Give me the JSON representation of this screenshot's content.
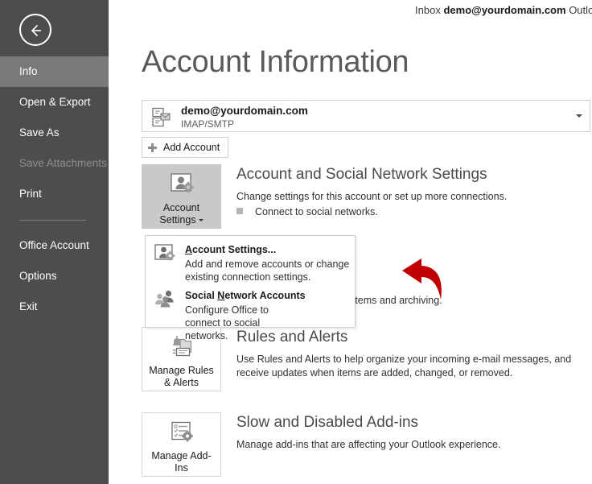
{
  "window": {
    "topbar": {
      "prefix": "Inbox",
      "account": "demo@yourdomain.com",
      "suffix": "Outlook"
    }
  },
  "sidebar": {
    "back_button": "back-arrow-icon",
    "items": [
      {
        "label": "Info",
        "state": "selected"
      },
      {
        "label": "Open & Export",
        "state": "normal"
      },
      {
        "label": "Save As",
        "state": "normal"
      },
      {
        "label": "Save Attachments",
        "state": "disabled"
      },
      {
        "label": "Print",
        "state": "normal"
      },
      {
        "label": "Office Account",
        "state": "normal"
      },
      {
        "label": "Options",
        "state": "normal"
      },
      {
        "label": "Exit",
        "state": "normal"
      }
    ]
  },
  "main": {
    "page_title": "Account Information",
    "account_selector": {
      "email": "demo@yourdomain.com",
      "type": "IMAP/SMTP",
      "icon": "mail-account-icon",
      "chevron": "chevron-down-icon"
    },
    "add_account_button": "Add Account",
    "sections": [
      {
        "button_label_line1": "Account",
        "button_label_line2": "Settings",
        "title": "Account and Social Network Settings",
        "desc": "Change settings for this account or set up more connections.",
        "bullet": "Connect to social networks."
      },
      {
        "button_label_line1": "Manage Rules",
        "button_label_line2": "& Alerts",
        "title": "Rules and Alerts",
        "desc": "Use Rules and Alerts to help organize your incoming e-mail messages, and receive updates when items are added, changed, or removed."
      },
      {
        "button_label_line1": "Manage Add-",
        "button_label_line2": "Ins",
        "title": "Slow and Disabled Add-ins",
        "desc": "Manage add-ins that are affecting your Outlook experience."
      }
    ],
    "obscured_text": "lbox by emptying Deleted Items and archiving."
  },
  "dropdown": {
    "items": [
      {
        "title_before": "",
        "title_underlined": "A",
        "title_after": "ccount Settings...",
        "desc": "Add and remove accounts or change existing connection settings.",
        "icon": "account-settings-icon"
      },
      {
        "title_before": "Social ",
        "title_underlined": "N",
        "title_after": "etwork Accounts",
        "desc": "Configure Office to connect to social networks.",
        "icon": "social-network-icon"
      }
    ]
  },
  "annotation": {
    "arrow_color": "#c00000",
    "arrow_name": "red-callout-arrow"
  },
  "colors": {
    "sidebar_bg": "#4d4d4d",
    "sidebar_selected": "#797979",
    "page_bg": "#ffffff",
    "title_gray": "#5a5a5a",
    "accent_red": "#c00000"
  }
}
